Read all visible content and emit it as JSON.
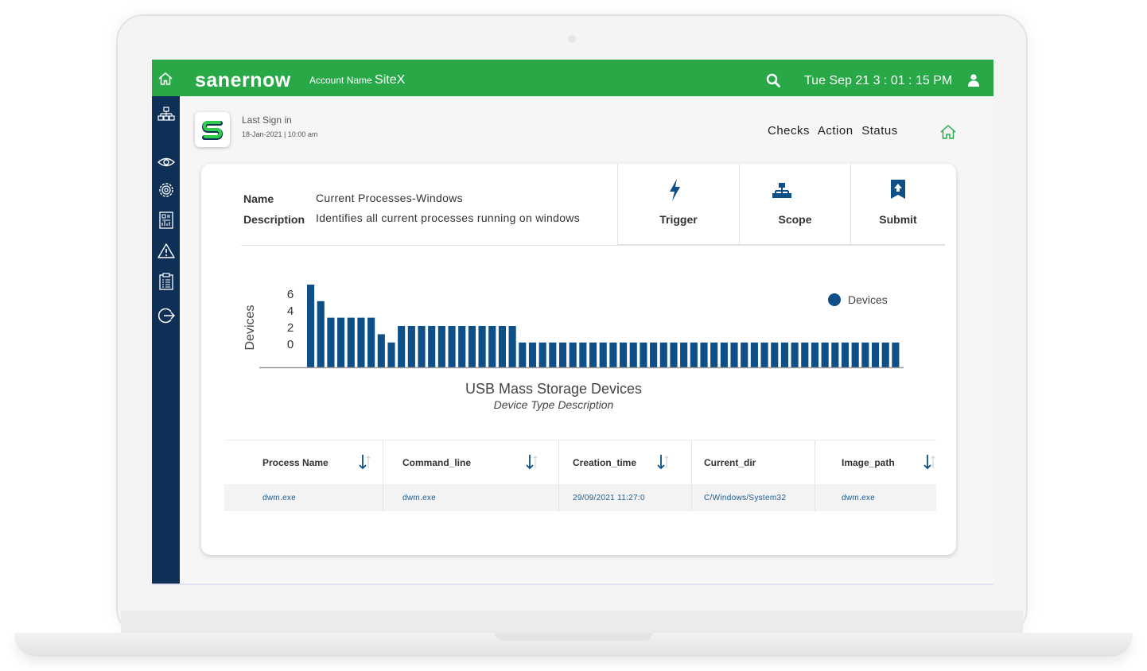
{
  "header": {
    "brand": "sanernow",
    "account_label": "Account Name",
    "account_name": "SiteX",
    "datetime": "Tue Sep 21  3 : 01 : 15 PM"
  },
  "sidebar": {
    "items": [
      "dashboard-tree-icon",
      "eye-icon",
      "gear-icon",
      "report-icon",
      "alert-icon",
      "clipboard-icon",
      "logout-icon"
    ]
  },
  "signin": {
    "label": "Last Sign in",
    "date": "18-Jan-2021 | 10:00 am"
  },
  "nav": {
    "checks": "Checks",
    "action": "Action",
    "status": "Status"
  },
  "check": {
    "name_label": "Name",
    "name_value": "Current Processes-Windows",
    "description_label": "Description",
    "description_value": "Identifies all current processes running on windows"
  },
  "actions": {
    "trigger": "Trigger",
    "scope": "Scope",
    "submit": "Submit"
  },
  "colors": {
    "brand_green": "#28a846",
    "sidebar_navy": "#0e3057",
    "bar_blue": "#0d4f86"
  },
  "chart_data": {
    "type": "bar",
    "title": "USB Mass Storage Devices",
    "subtitle": "Device Type Description",
    "xlabel": "",
    "ylabel": "Devices",
    "yticks": [
      "6",
      "4",
      "2",
      "0"
    ],
    "legend": [
      {
        "name": "Devices",
        "color": "#0d4f86"
      }
    ],
    "legend_position": "top-right",
    "values": [
      10,
      8,
      6,
      6,
      6,
      6,
      6,
      4,
      3,
      5,
      5,
      5,
      5,
      5,
      5,
      5,
      5,
      5,
      5,
      5,
      5,
      3,
      3,
      3,
      3,
      3,
      3,
      3,
      3,
      3,
      3,
      3,
      3,
      3,
      3,
      3,
      3,
      3,
      3,
      3,
      3,
      3,
      3,
      3,
      3,
      3,
      3,
      3,
      3,
      3,
      3,
      3,
      3,
      3,
      3,
      3,
      3,
      3,
      3
    ],
    "ylim": [
      0,
      10
    ]
  },
  "table": {
    "columns": [
      "Process Name",
      "Command_line",
      "Creation_time",
      "Current_dir",
      "Image_path"
    ],
    "rows": [
      [
        "dwm.exe",
        "dwm.exe",
        "29/09/2021 11:27:0",
        "C/Windows/System32",
        "dwm.exe"
      ]
    ]
  }
}
